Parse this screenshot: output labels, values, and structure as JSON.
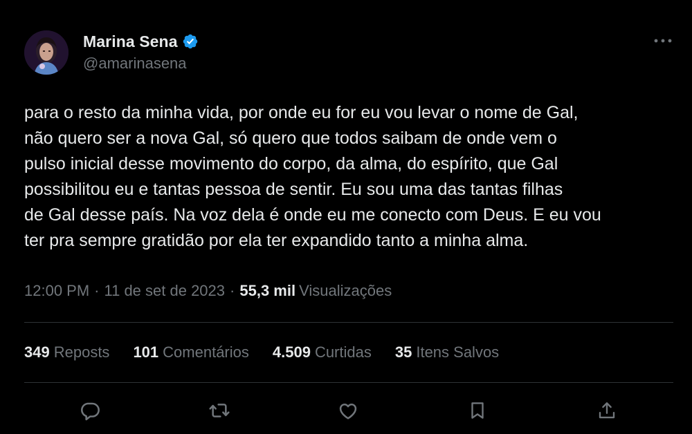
{
  "author": {
    "display_name": "Marina Sena",
    "handle": "@amarinasena",
    "verified_icon": "verified-badge-icon",
    "avatar_icon": "profile-photo"
  },
  "tweet": {
    "text": "para o resto da minha vida, por onde eu for eu vou levar o nome de Gal,\nnão quero ser a nova Gal, só quero que todos saibam de onde vem o\npulso inicial desse movimento do corpo, da alma, do espírito, que Gal\npossibilitou eu e tantas pessoa de sentir. Eu sou uma das tantas filhas\nde Gal desse país. Na voz dela é onde eu me conecto com Deus. E eu vou\nter pra sempre gratidão por ela ter expandido tanto a minha alma."
  },
  "meta": {
    "time": "12:00 PM",
    "separator": "·",
    "date": "11 de set de 2023",
    "views_count": "55,3 mil",
    "views_label": "Visualizações"
  },
  "stats": [
    {
      "count": "349",
      "label": "Reposts"
    },
    {
      "count": "101",
      "label": "Comentários"
    },
    {
      "count": "4.509",
      "label": "Curtidas"
    },
    {
      "count": "35",
      "label": "Itens Salvos"
    }
  ],
  "actions": [
    "reply-icon",
    "retweet-icon",
    "like-icon",
    "bookmark-icon",
    "share-icon"
  ],
  "colors": {
    "background": "#000000",
    "text_primary": "#e7e9ea",
    "text_secondary": "#71767b",
    "divider": "#2f3336",
    "verified": "#1d9bf0"
  }
}
